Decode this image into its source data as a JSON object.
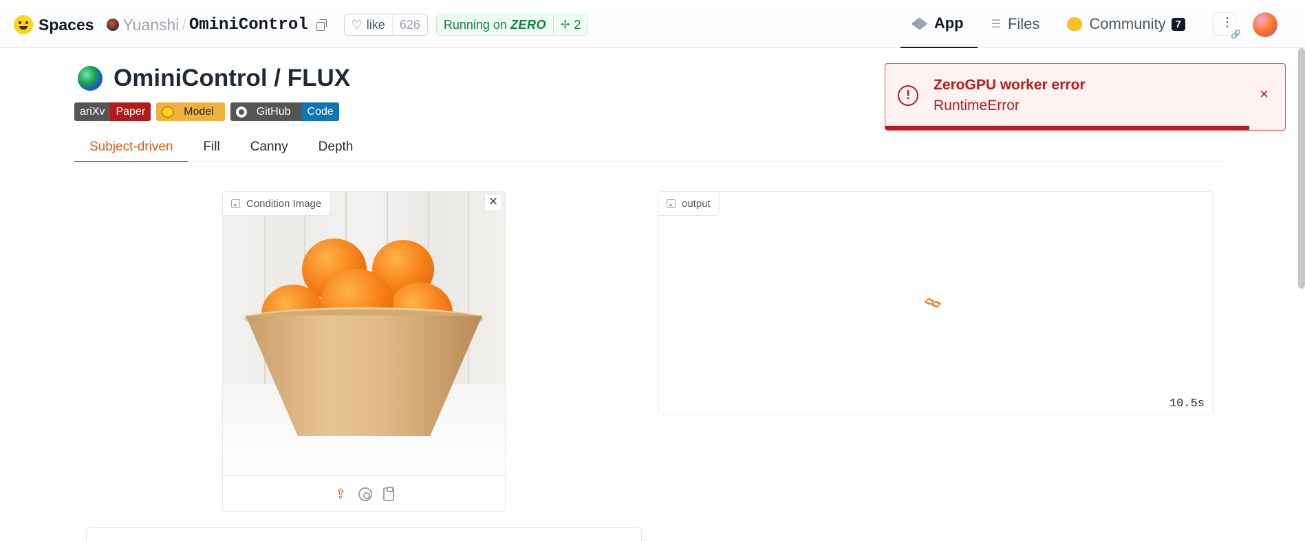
{
  "topbar": {
    "brand": "Spaces",
    "owner": "Yuanshi",
    "separator": "/",
    "repo": "OminiControl",
    "like_label": "like",
    "like_count": "626",
    "running_prefix": "Running on",
    "running_hardware": "ZERO",
    "workers": "2",
    "nav": [
      {
        "label": "App",
        "icon": "app-cube-icon",
        "active": true
      },
      {
        "label": "Files",
        "icon": "files-icon",
        "active": false
      },
      {
        "label": "Community",
        "icon": "community-icon",
        "active": false,
        "badge": "7"
      }
    ]
  },
  "header": {
    "title": "OminiControl / FLUX",
    "badges": [
      {
        "left": "ariXv",
        "right": "Paper"
      },
      {
        "left": "Model"
      },
      {
        "left": "GitHub",
        "right": "Code"
      }
    ]
  },
  "tabs": [
    {
      "label": "Subject-driven",
      "active": true
    },
    {
      "label": "Fill",
      "active": false
    },
    {
      "label": "Canny",
      "active": false
    },
    {
      "label": "Depth",
      "active": false
    }
  ],
  "toast": {
    "title": "ZeroGPU worker error",
    "message": "RuntimeError",
    "progress": 0.91,
    "close": "×"
  },
  "condition_panel": {
    "label": "Condition Image",
    "close": "×"
  },
  "output_panel": {
    "label": "output",
    "timer": "10.5s"
  },
  "colors": {
    "accent": "#ea580c",
    "error": "#b91c1c",
    "error_bg": "#fef2f2",
    "running": "#15803d"
  }
}
